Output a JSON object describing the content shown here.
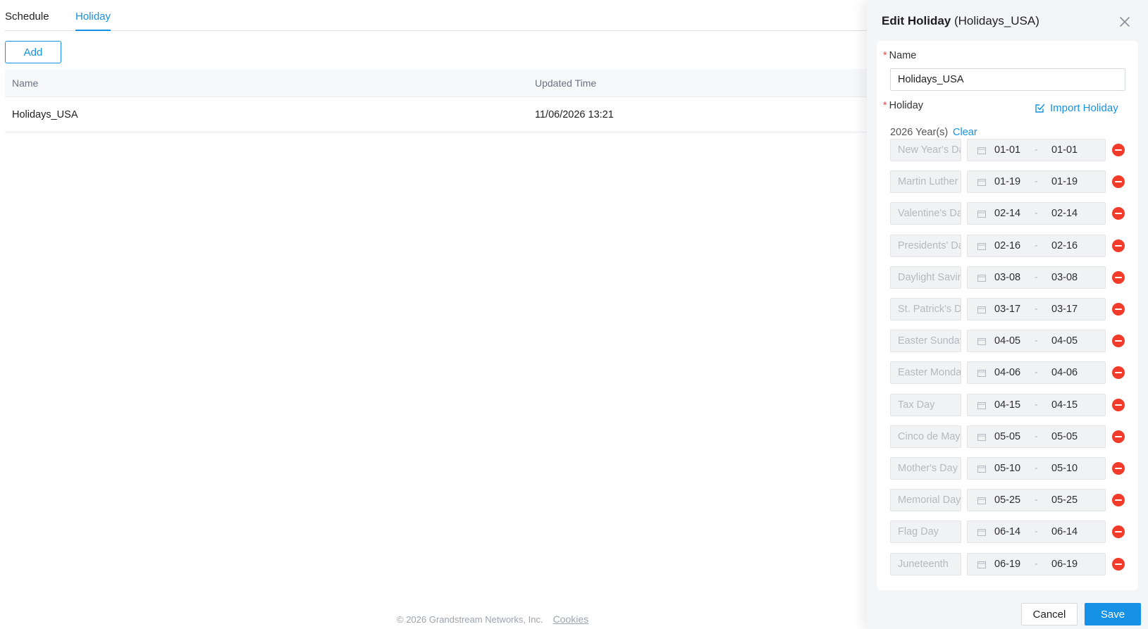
{
  "tabs": [
    {
      "label": "Schedule",
      "active": false
    },
    {
      "label": "Holiday",
      "active": true
    }
  ],
  "toolbar": {
    "add_label": "Add"
  },
  "table": {
    "headers": [
      "Name",
      "Updated Time"
    ],
    "rows": [
      {
        "name": "Holidays_USA",
        "updated": "11/06/2026 13:21"
      }
    ]
  },
  "footer": {
    "copyright": "© 2026 Grandstream Networks, Inc.",
    "cookies": "Cookies"
  },
  "drawer": {
    "title_bold": "Edit Holiday",
    "title_rest": "(Holidays_USA)",
    "name_label": "Name",
    "name_value": "Holidays_USA",
    "holiday_label": "Holiday",
    "import_label": "Import Holiday",
    "year_label": "2026 Year(s)",
    "clear_label": "Clear",
    "required_mark": "*",
    "date_separator": "-",
    "holidays": [
      {
        "name": "New Year's Day",
        "start": "01-01",
        "end": "01-01"
      },
      {
        "name": "Martin Luther King Jr. Day",
        "start": "01-19",
        "end": "01-19"
      },
      {
        "name": "Valentine's Day",
        "start": "02-14",
        "end": "02-14"
      },
      {
        "name": "Presidents' Day",
        "start": "02-16",
        "end": "02-16"
      },
      {
        "name": "Daylight Saving Time starts",
        "start": "03-08",
        "end": "03-08"
      },
      {
        "name": "St. Patrick's Day",
        "start": "03-17",
        "end": "03-17"
      },
      {
        "name": "Easter Sunday",
        "start": "04-05",
        "end": "04-05"
      },
      {
        "name": "Easter Monday",
        "start": "04-06",
        "end": "04-06"
      },
      {
        "name": "Tax Day",
        "start": "04-15",
        "end": "04-15"
      },
      {
        "name": "Cinco de Mayo",
        "start": "05-05",
        "end": "05-05"
      },
      {
        "name": "Mother's Day",
        "start": "05-10",
        "end": "05-10"
      },
      {
        "name": "Memorial Day",
        "start": "05-25",
        "end": "05-25"
      },
      {
        "name": "Flag Day",
        "start": "06-14",
        "end": "06-14"
      },
      {
        "name": "Juneteenth",
        "start": "06-19",
        "end": "06-19"
      }
    ],
    "cancel_label": "Cancel",
    "save_label": "Save"
  },
  "colors": {
    "accent": "#1592e6",
    "danger": "#f23b2a",
    "drawer_bg": "#f4f5f7"
  }
}
